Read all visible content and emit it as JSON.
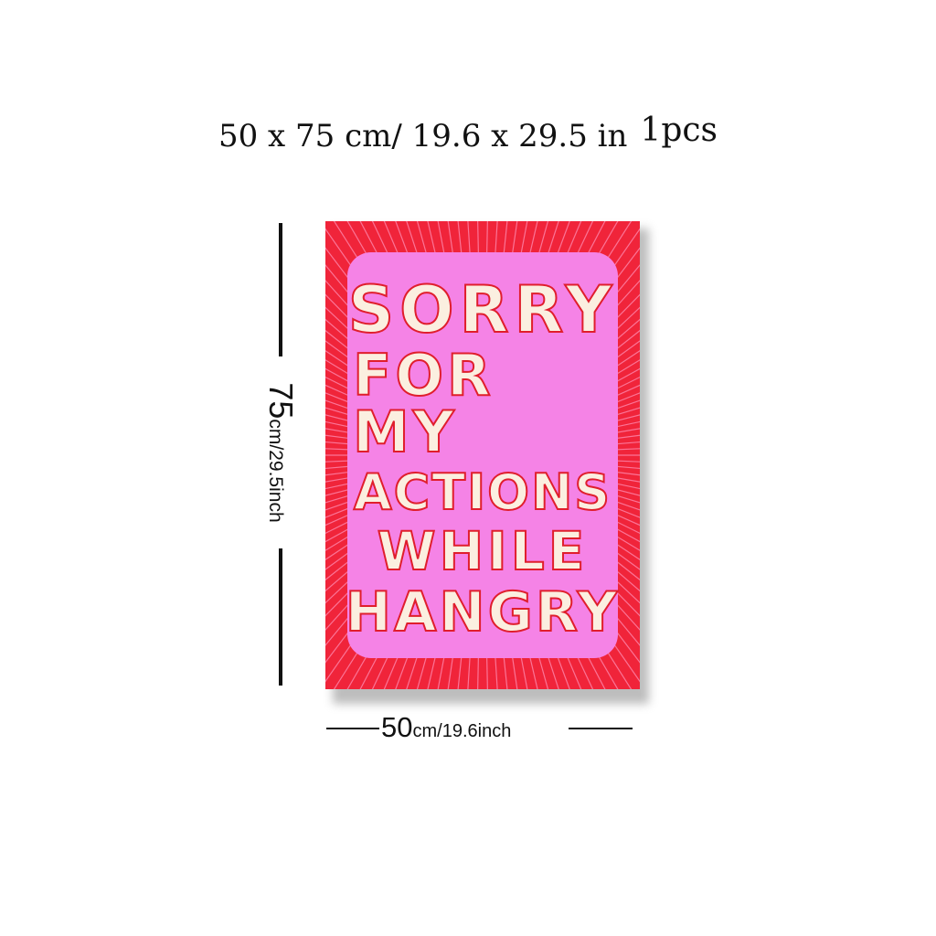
{
  "title": {
    "dimensions": "50 x 75 cm/ 19.6  x  29.5  in",
    "quantity": "1pcs"
  },
  "poster": {
    "lines": [
      "SORRY",
      "FOR MY",
      "ACTIONS",
      "WHILE",
      "HANGRY"
    ],
    "colors": {
      "border": "#f0243a",
      "border_stripes": "#ff8fb6",
      "panel": "#f583e6",
      "letters": "#fbefe0",
      "letter_outline": "#e01e2c"
    }
  },
  "height_label": {
    "value": "75",
    "unit": "cm/29.5inch"
  },
  "width_label": {
    "value": "50",
    "unit": "cm/19.6inch"
  }
}
